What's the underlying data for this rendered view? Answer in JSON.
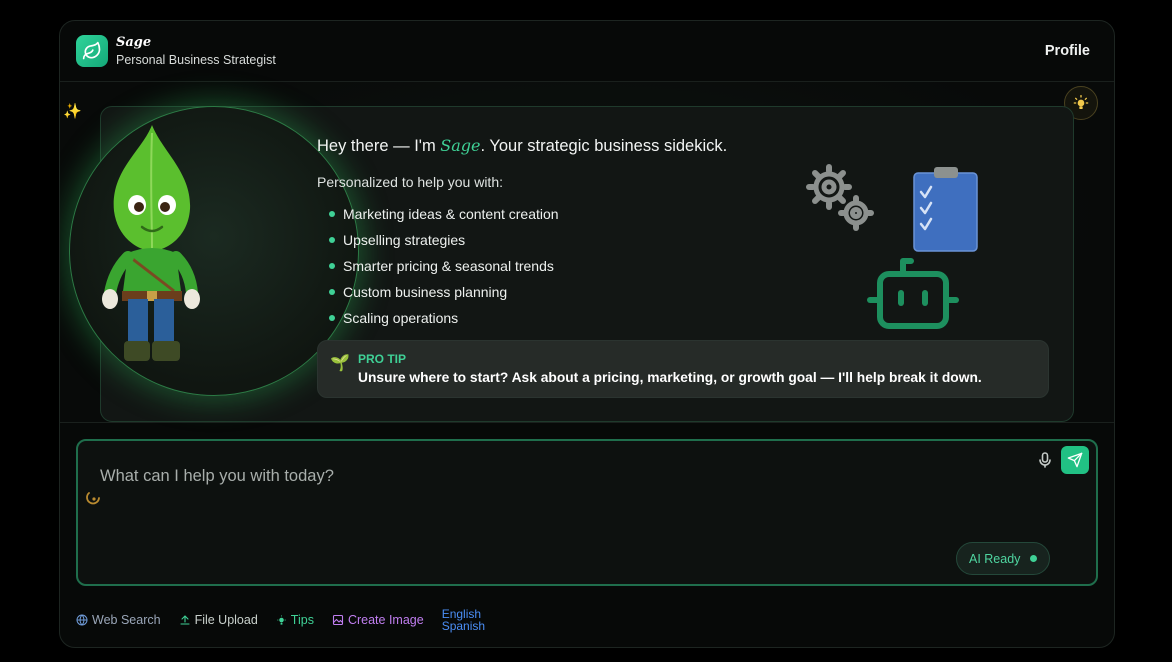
{
  "header": {
    "brand_name": "Sage",
    "brand_subtitle": "Personal Business Strategist",
    "profile_label": "Profile"
  },
  "hero": {
    "greeting_prefix": "Hey there — I'm ",
    "greeting_name": "Sage",
    "greeting_suffix": ". Your strategic business sidekick.",
    "intro": "Personalized to help you with:",
    "features": [
      "Marketing ideas & content creation",
      "Upselling strategies",
      "Smarter pricing & seasonal trends",
      "Custom business planning",
      "Scaling operations"
    ],
    "tip_label": "PRO TIP",
    "tip_text": "Unsure where to start? Ask about a pricing, marketing, or growth goal — I'll help break it down."
  },
  "composer": {
    "placeholder": "What can I help you with today?",
    "status": "AI Ready"
  },
  "toolbar": {
    "web_search": "Web Search",
    "file_upload": "File Upload",
    "tips": "Tips",
    "create_image": "Create Image",
    "lang_english": "English",
    "lang_spanish": "Spanish"
  },
  "colors": {
    "accent": "#3fd196",
    "send_button": "#21c184",
    "web_search": "#9aa6b8",
    "file_upload": "#c8d0cb",
    "tips": "#3fd196",
    "create_image": "#c07ef0",
    "language": "#4b8ef5"
  },
  "icons": {
    "logo": "leaf-icon",
    "sparkle": "sparkle-icon",
    "bulb": "lightbulb-icon",
    "tip": "seedling-icon",
    "mic": "microphone-icon",
    "send": "send-icon",
    "loader": "loader-icon"
  }
}
